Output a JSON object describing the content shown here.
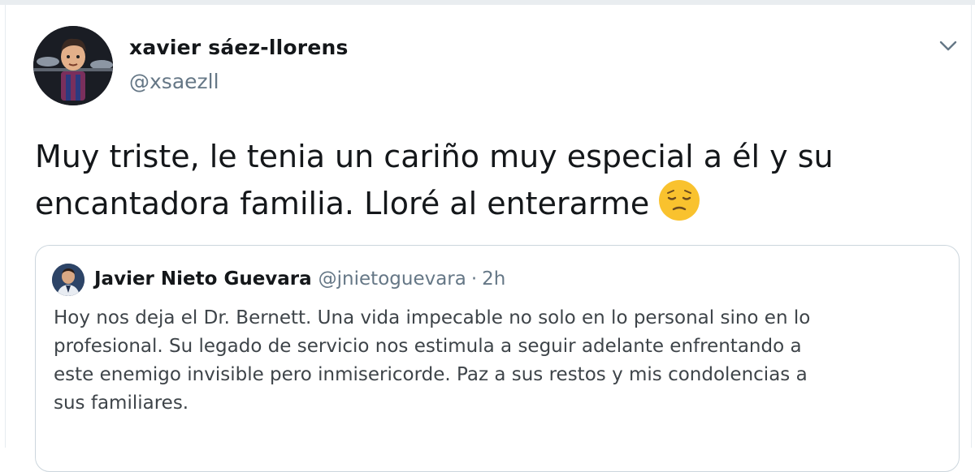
{
  "tweet": {
    "author_name": "xavier sáez-llorens",
    "author_handle": "@xsaezll",
    "text_lines": [
      "Muy triste, le tenia un cariño muy especial a él y su",
      "encantadora familia. Lloré al enterarme"
    ],
    "emoji_icon": "pensive-face-icon"
  },
  "quoted_tweet": {
    "author_name": "Javier Nieto Guevara",
    "author_handle": "@jnietoguevara",
    "separator": "·",
    "time": "2h",
    "text_lines": [
      "Hoy nos deja el Dr. Bernett. Una vida impecable no solo en lo personal sino en lo",
      "profesional. Su  legado de servicio nos estimula a seguir adelante enfrentando a",
      "este enemigo invisible pero inmisericorde.  Paz a sus restos y mis condolencias a",
      "sus familiares."
    ]
  },
  "colors": {
    "text_primary": "#14171a",
    "text_secondary": "#657786",
    "border": "#ccd6dd",
    "emoji_yellow": "#f9c22e"
  },
  "icons": {
    "menu": "chevron-down-icon"
  }
}
